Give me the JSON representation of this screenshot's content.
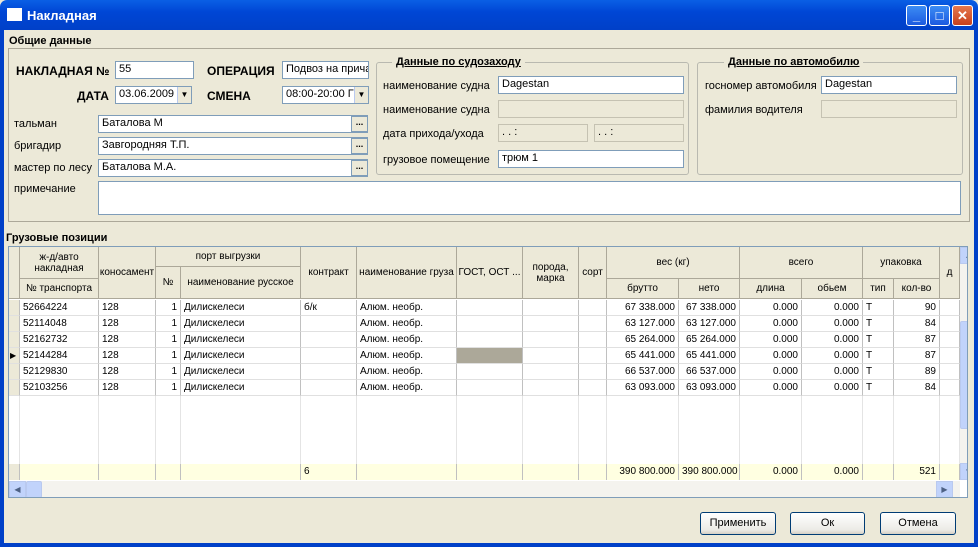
{
  "window": {
    "title": "Накладная"
  },
  "general": {
    "title": "Общие данные",
    "nakl_label": "НАКЛАДНАЯ №",
    "nakl_value": "55",
    "date_label": "ДАТА",
    "date_value": "03.06.2009",
    "op_label": "ОПЕРАЦИЯ",
    "op_value": "Подвоз на прича",
    "shift_label": "СМЕНА",
    "shift_value": "08:00-20:00 Г",
    "talman_label": "тальман",
    "talman_value": "Баталова М",
    "brig_label": "бригадир",
    "brig_value": "Завгородняя Т.П.",
    "master_label": "мастер по лесу",
    "master_value": "Баталова М.А.",
    "note_label": "примечание",
    "note_value": "",
    "ellipsis": "..."
  },
  "vessel": {
    "title": "Данные по судозаходу",
    "name_label": "наименование судна",
    "name_value": "Dagestan",
    "name2_label": "наименование судна",
    "name2_value": "",
    "arrival_label": "дата прихода/ухода",
    "arrival1": " .  .     :",
    "arrival2": " .  .     :",
    "hold_label": "грузовое помещение",
    "hold_value": "трюм 1"
  },
  "auto": {
    "title": "Данные по автомобилю",
    "plate_label": "госномер автомобиля",
    "plate_value": "Dagestan",
    "driver_label": "фамилия водителя",
    "driver_value": ""
  },
  "cargo": {
    "title": "Грузовые позиции",
    "headers": {
      "zd": "ж-д/авто накладная",
      "ntr": "№ транспорта",
      "kon": "коносамент",
      "port": "порт выгрузки",
      "n": "№",
      "name_ru": "наименование русское",
      "contract": "контракт",
      "cargo_name": "наименование груза",
      "gost": "ГОСТ, ОСТ ...",
      "breed": "порода, марка",
      "sort": "сорт",
      "weight": "вес (кг)",
      "gross": "брутто",
      "net": "нето",
      "total": "всего",
      "length": "длина",
      "volume": "обьем",
      "pack": "упаковка",
      "type": "тип",
      "qty": "кол-во",
      "d": "д"
    },
    "rows": [
      {
        "ntr": "52664224",
        "kon": "128",
        "n": "1",
        "port": "Дилискелеси",
        "contract": "б/к",
        "cargo": "Алюм. необр.",
        "gross": "67 338.000",
        "net": "67 338.000",
        "length": "0.000",
        "volume": "0.000",
        "type": "T",
        "qty": "90"
      },
      {
        "ntr": "52114048",
        "kon": "128",
        "n": "1",
        "port": "Дилискелеси",
        "contract": "",
        "cargo": "Алюм. необр.",
        "gross": "63 127.000",
        "net": "63 127.000",
        "length": "0.000",
        "volume": "0.000",
        "type": "T",
        "qty": "84"
      },
      {
        "ntr": "52162732",
        "kon": "128",
        "n": "1",
        "port": "Дилискелеси",
        "contract": "",
        "cargo": "Алюм. необр.",
        "gross": "65 264.000",
        "net": "65 264.000",
        "length": "0.000",
        "volume": "0.000",
        "type": "T",
        "qty": "87"
      },
      {
        "ntr": "52144284",
        "kon": "128",
        "n": "1",
        "port": "Дилискелеси",
        "contract": "",
        "cargo": "Алюм. необр.",
        "gross": "65 441.000",
        "net": "65 441.000",
        "length": "0.000",
        "volume": "0.000",
        "type": "T",
        "qty": "87"
      },
      {
        "ntr": "52129830",
        "kon": "128",
        "n": "1",
        "port": "Дилискелеси",
        "contract": "",
        "cargo": "Алюм. необр.",
        "gross": "66 537.000",
        "net": "66 537.000",
        "length": "0.000",
        "volume": "0.000",
        "type": "T",
        "qty": "89"
      },
      {
        "ntr": "52103256",
        "kon": "128",
        "n": "1",
        "port": "Дилискелеси",
        "contract": "",
        "cargo": "Алюм. необр.",
        "gross": "63 093.000",
        "net": "63 093.000",
        "length": "0.000",
        "volume": "0.000",
        "type": "T",
        "qty": "84"
      }
    ],
    "footer": {
      "contract": "6",
      "gross": "390 800.000",
      "net": "390 800.000",
      "length": "0.000",
      "volume": "0.000",
      "qty": "521"
    }
  },
  "buttons": {
    "apply": "Применить",
    "ok": "Ок",
    "cancel": "Отмена"
  }
}
